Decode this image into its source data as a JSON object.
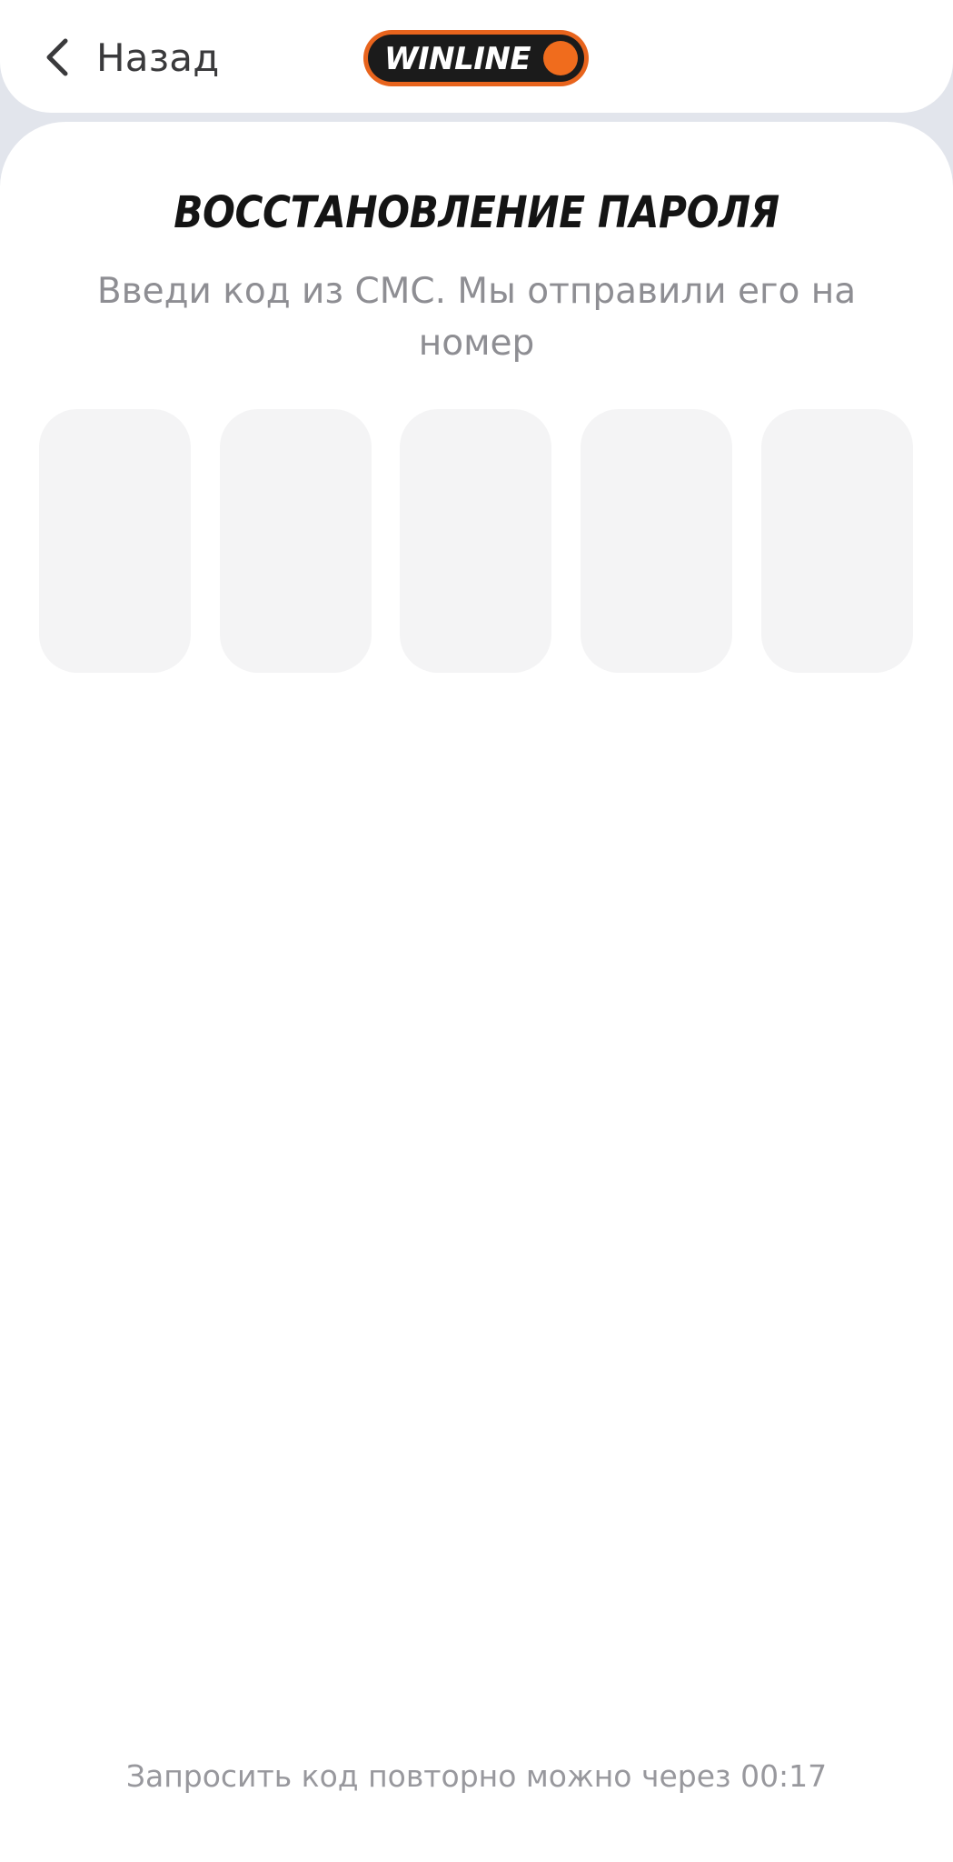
{
  "header": {
    "back_label": "Назад",
    "back_icon": "chevron-left-icon",
    "logo_text": "WINLINE",
    "logo_colors": {
      "ring": "#e8641d",
      "body": "#1b1b1b",
      "dot": "#f06c1d"
    }
  },
  "main": {
    "title": "ВОССТАНОВЛЕНИЕ ПАРОЛЯ",
    "subtitle_line1": "Введи код из СМС. Мы отправили его на",
    "subtitle_line2": "номер",
    "code_digits": [
      "",
      "",
      "",
      "",
      ""
    ],
    "resend_text": "Запросить код повторно можно через 00:17"
  },
  "colors": {
    "background": "#e2e5ec",
    "card": "#ffffff",
    "code_box": "#f4f4f5",
    "muted_text": "#8e8e93"
  }
}
